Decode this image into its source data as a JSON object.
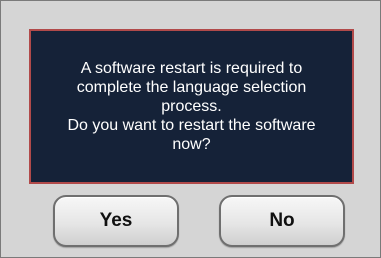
{
  "dialog": {
    "message": "A software restart is required to\ncomplete the language selection\nprocess.\nDo you want to restart the software\nnow?",
    "buttons": {
      "yes_label": "Yes",
      "no_label": "No"
    }
  },
  "colors": {
    "dialog_background": "#d5d5d5",
    "message_background": "#152238",
    "message_border": "#b14a4a",
    "message_text": "#ffffff"
  }
}
